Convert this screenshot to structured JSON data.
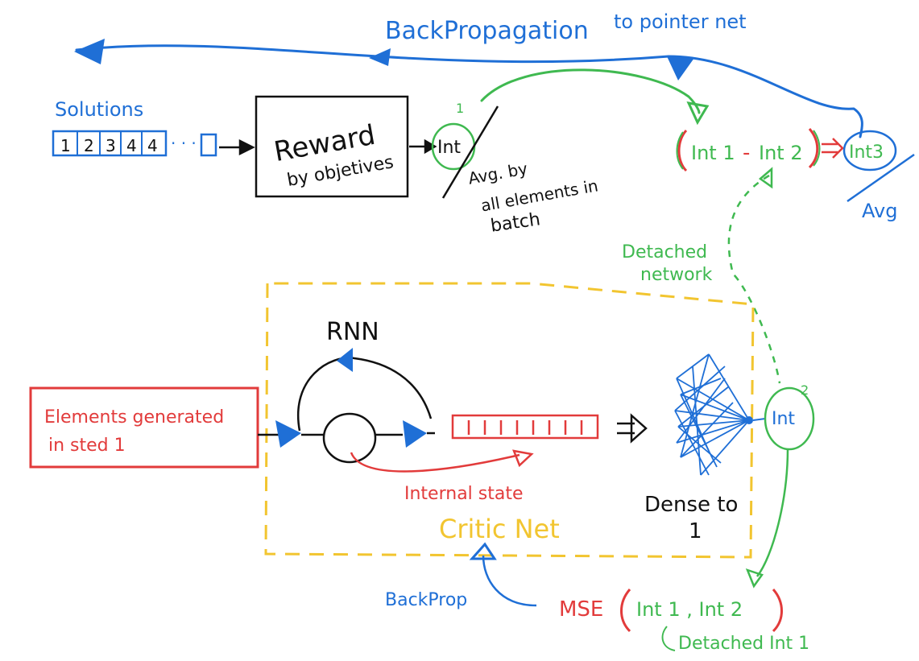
{
  "colors": {
    "blue": "#1f6fd6",
    "green": "#3fb950",
    "red": "#e23b3b",
    "black": "#111111",
    "yellow": "#f2c530"
  },
  "top": {
    "backprop_label": "BackPropagation",
    "backprop_suffix": "to pointer net",
    "solutions_label": "Solutions",
    "solution_cells": [
      "1",
      "2",
      "3",
      "4",
      "4"
    ],
    "solution_ellipsis": "· · ·",
    "reward_line1": "Reward",
    "reward_line2": "by objetives",
    "int_label": "Int",
    "int_index": "1",
    "avg_note_line1": "Avg. by",
    "avg_note_line2": "all elements in",
    "avg_note_line3": "batch",
    "diff_int1": "Int 1",
    "diff_minus": "-",
    "diff_int2": "Int 2",
    "int3_label": "Int3",
    "avg_label": "Avg"
  },
  "detached_label_line1": "Detached",
  "detached_label_line2": "network",
  "critic": {
    "elements_line1": "Elements generated",
    "elements_line2": "in sted 1",
    "rnn_label": "RNN",
    "internal_state_label": "Internal state",
    "critic_net_label": "Critic Net",
    "dense_line1": "Dense to",
    "dense_line2": "1",
    "int_label": "Int",
    "int_index": "2"
  },
  "bottom": {
    "backprop_label": "BackProp",
    "mse_label": "MSE",
    "mse_args": "Int 1  , Int 2",
    "detached_note": "Detached Int 1"
  }
}
